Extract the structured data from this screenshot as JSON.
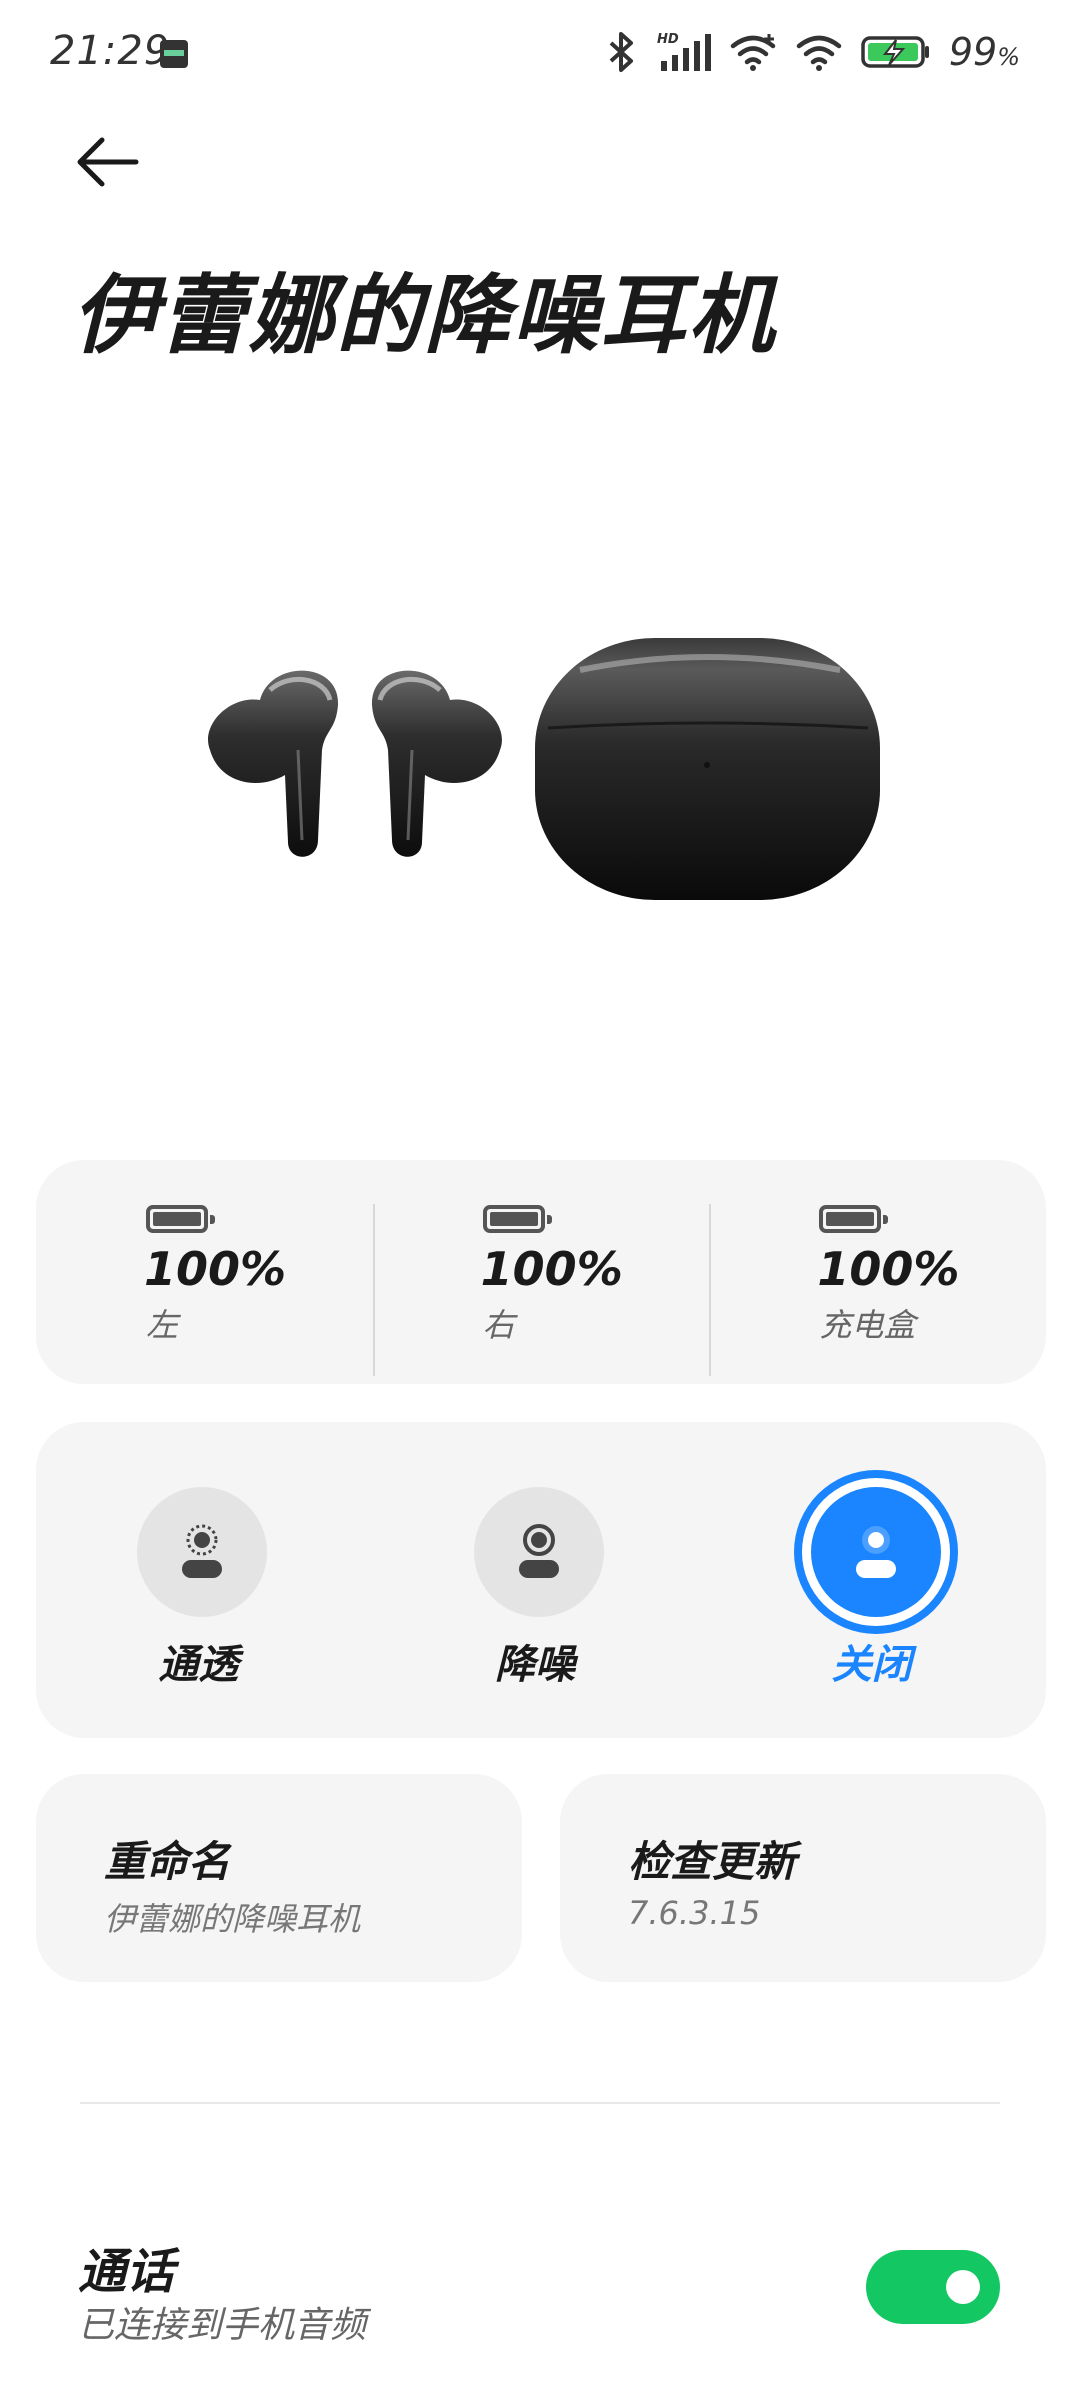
{
  "status_bar": {
    "time": "21:29",
    "network_label": "HD",
    "battery_percent": "99",
    "battery_unit": "%",
    "icons": [
      "sim-card-icon",
      "bluetooth-icon",
      "signal-icon",
      "wifi-icon",
      "wifi-icon",
      "battery-charging-icon"
    ]
  },
  "header": {
    "back_icon": "back-arrow-icon",
    "title": "伊蕾娜的降噪耳机"
  },
  "product_image": "earbuds-and-case",
  "battery": {
    "items": [
      {
        "value": "100%",
        "label": "左",
        "level": 1.0
      },
      {
        "value": "100%",
        "label": "右",
        "level": 1.0
      },
      {
        "value": "100%",
        "label": "充电盒",
        "level": 1.0
      }
    ]
  },
  "modes": {
    "items": [
      {
        "label": "通透",
        "icon": "transparency-mode-icon",
        "active": false
      },
      {
        "label": "降噪",
        "icon": "noise-cancel-mode-icon",
        "active": false
      },
      {
        "label": "关闭",
        "icon": "mode-off-icon",
        "active": true
      }
    ],
    "accent_color": "#1a85ff"
  },
  "cards": {
    "rename": {
      "title": "重命名",
      "subtitle": "伊蕾娜的降噪耳机"
    },
    "update": {
      "title": "检查更新",
      "subtitle": "7.6.3.15"
    }
  },
  "call": {
    "title": "通话",
    "subtitle": "已连接到手机音频",
    "enabled": true,
    "toggle_color": "#13c763"
  }
}
